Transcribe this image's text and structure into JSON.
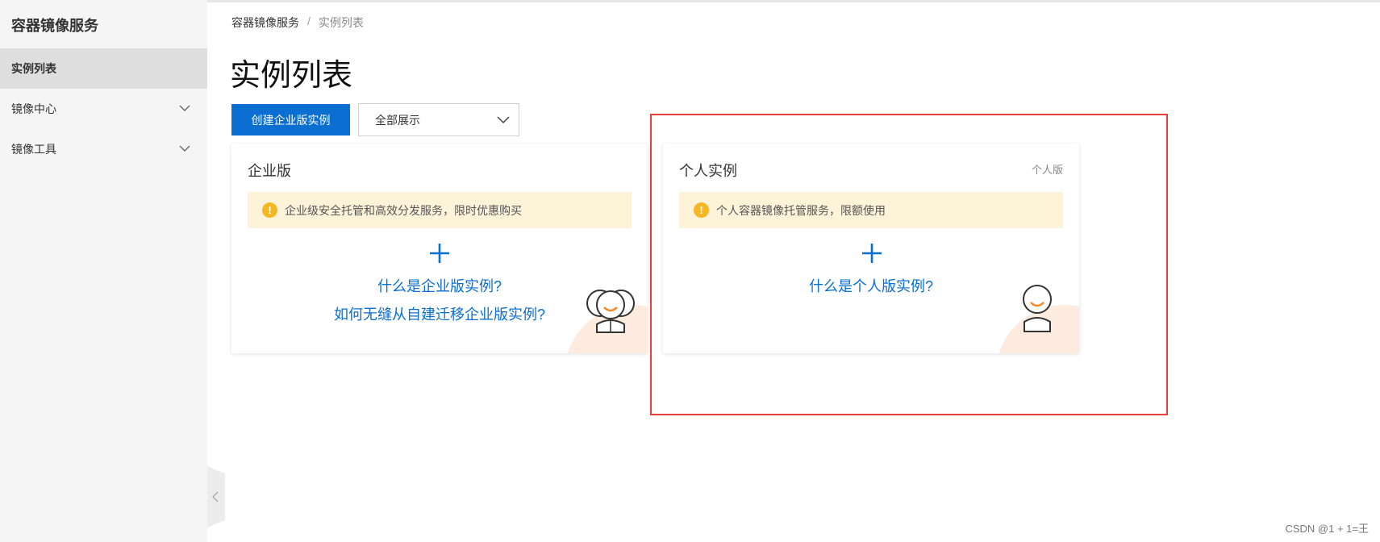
{
  "sidebar": {
    "title": "容器镜像服务",
    "items": [
      {
        "label": "实例列表",
        "active": true
      },
      {
        "label": "镜像中心",
        "expandable": true
      },
      {
        "label": "镜像工具",
        "expandable": true
      }
    ]
  },
  "breadcrumb": {
    "root": "容器镜像服务",
    "separator": "/",
    "current": "实例列表"
  },
  "page": {
    "title": "实例列表"
  },
  "toolbar": {
    "create_label": "创建企业版实例",
    "filter_value": "全部展示"
  },
  "cards": {
    "enterprise": {
      "title": "企业版",
      "notice": "企业级安全托管和高效分发服务，限时优惠购买",
      "link1": "什么是企业版实例?",
      "link2": "如何无缝从自建迁移企业版实例?"
    },
    "personal": {
      "title": "个人实例",
      "tag": "个人版",
      "notice": "个人容器镜像托管服务，限额使用",
      "link1": "什么是个人版实例?"
    }
  },
  "colors": {
    "primary": "#0a6fd0",
    "notice_bg": "#fdf3d9",
    "warn": "#f5b723",
    "highlight_border": "#ee3b3b",
    "illustration_bg": "#fdebe0",
    "smile": "#f08a2c"
  },
  "watermark": "CSDN @1 + 1=王"
}
